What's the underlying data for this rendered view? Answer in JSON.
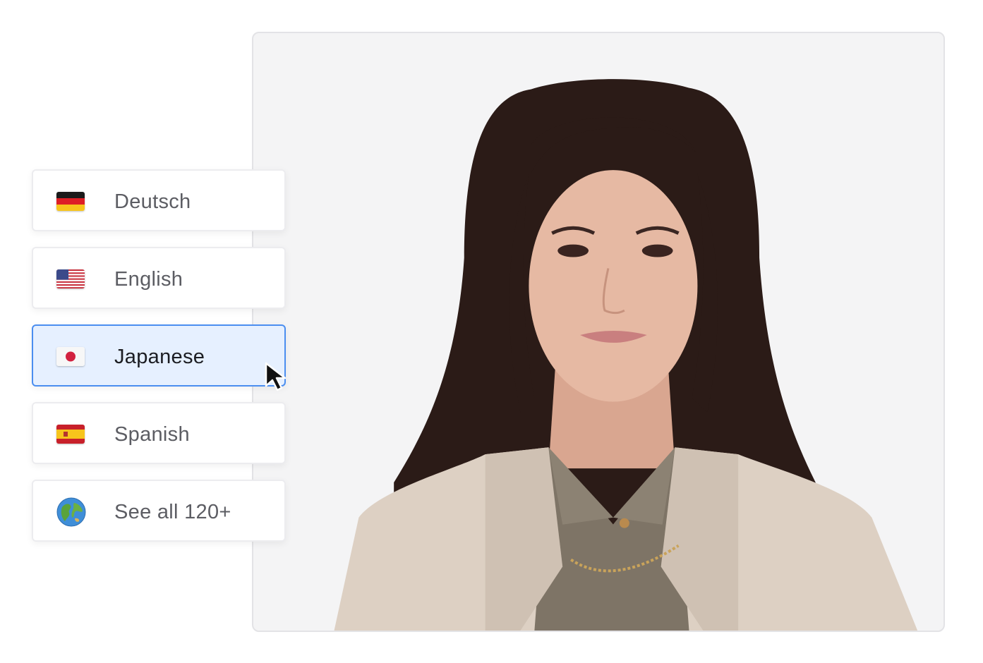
{
  "languages": [
    {
      "label": "Deutsch",
      "icon": "germany-flag-icon"
    },
    {
      "label": "English",
      "icon": "us-flag-icon"
    },
    {
      "label": "Japanese",
      "icon": "japan-flag-icon",
      "selected": true
    },
    {
      "label": "Spanish",
      "icon": "spain-flag-icon"
    },
    {
      "label": "See all 120+",
      "icon": "globe-icon"
    }
  ],
  "colors": {
    "selected_background": "#e6f0ff",
    "selected_border": "#4b8ef0",
    "item_text": "#5c5d63",
    "selected_text": "#1c1d22",
    "frame_background": "#f4f4f5"
  }
}
